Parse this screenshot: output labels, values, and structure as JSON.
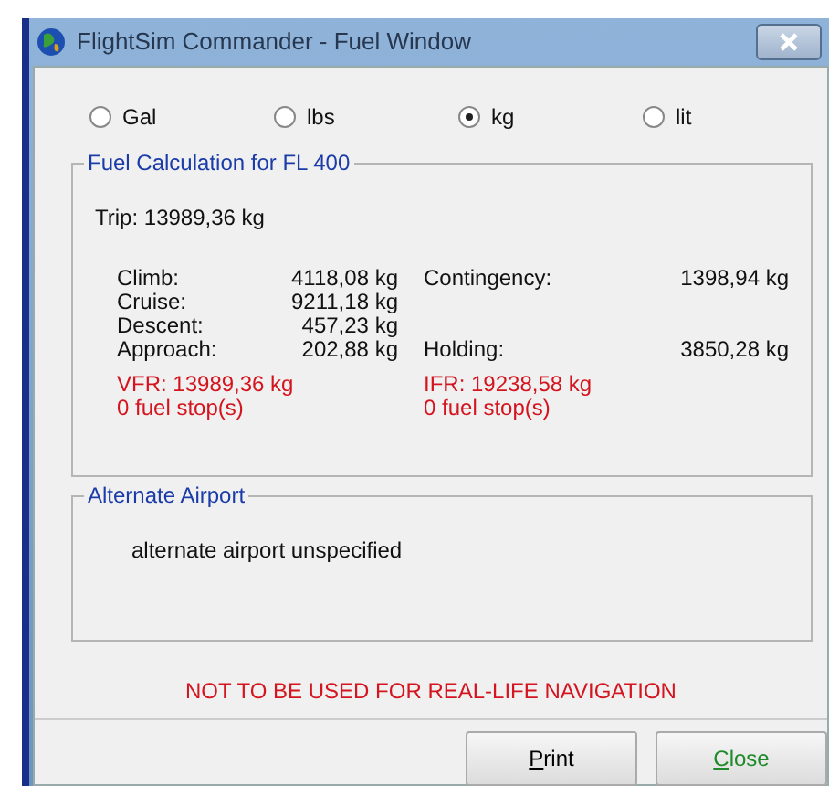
{
  "window": {
    "title": "FlightSim Commander - Fuel Window"
  },
  "units": [
    {
      "label": "Gal",
      "selected": false
    },
    {
      "label": "lbs",
      "selected": false
    },
    {
      "label": "kg",
      "selected": true
    },
    {
      "label": "lit",
      "selected": false
    }
  ],
  "fuel_calculation": {
    "title": "Fuel Calculation for FL 400",
    "trip": "Trip: 13989,36 kg",
    "left_rows": [
      {
        "label": "Climb:",
        "value": "4118,08 kg"
      },
      {
        "label": "Cruise:",
        "value": "9211,18 kg"
      },
      {
        "label": "Descent:",
        "value": "457,23 kg"
      },
      {
        "label": "Approach:",
        "value": "202,88 kg"
      }
    ],
    "right_rows": [
      {
        "label": "Contingency:",
        "value": "1398,94 kg"
      },
      {
        "label": "Holding:",
        "value": "3850,28 kg"
      }
    ],
    "vfr": {
      "total": "VFR: 13989,36 kg",
      "stops": "0 fuel stop(s)"
    },
    "ifr": {
      "total": "IFR: 19238,58 kg",
      "stops": "0 fuel stop(s)"
    }
  },
  "alternate_airport": {
    "title": "Alternate Airport",
    "text": "alternate airport unspecified"
  },
  "warning": "NOT TO BE USED FOR REAL-LIFE NAVIGATION",
  "buttons": [
    {
      "label": "Print",
      "kind": "plain"
    },
    {
      "label": "Close",
      "kind": "default"
    }
  ]
}
